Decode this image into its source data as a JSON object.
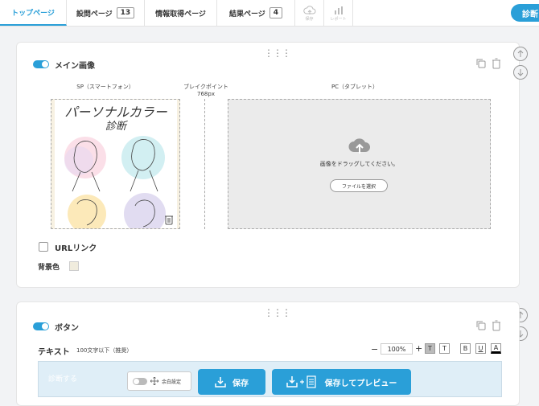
{
  "topbar": {
    "tabs": [
      {
        "label": "トップページ"
      },
      {
        "label": "設問ページ",
        "count": "13"
      },
      {
        "label": "情報取得ページ"
      },
      {
        "label": "結果ページ",
        "count": "4"
      }
    ],
    "tools": [
      {
        "icon": "cloud-save-icon",
        "label": "保存"
      },
      {
        "icon": "report-icon",
        "label": "レポート"
      }
    ],
    "diagnose_label": "診断"
  },
  "main_image": {
    "title": "メイン画像",
    "enabled": true,
    "sp_label": "SP（スマートフォン）",
    "breakpoint_label": "ブレイクポイント",
    "breakpoint_value": "768px",
    "pc_label": "PC（タブレット）",
    "drop_text": "画像をドラッグしてください。",
    "file_button": "ファイルを選択",
    "preview_title_line1": "パーソナルカラー",
    "preview_title_line2": "診断",
    "url_link_label": "URLリンク",
    "bg_color_label": "背景色",
    "bg_color": "#f0ecdd"
  },
  "button_section": {
    "title": "ボタン",
    "enabled": true,
    "text_label": "テキスト",
    "text_hint": "100文字以下（推奨）",
    "zoom": "100%",
    "minus": "−",
    "plus": "+",
    "fmt": [
      "T",
      "T",
      "B",
      "U",
      "A"
    ],
    "input_value": "診断する"
  },
  "bottom_bar": {
    "margin_toggle_label": "余白設定",
    "save_label": "保存",
    "save_preview_label": "保存してプレビュー"
  },
  "colors": {
    "accent": "#2a9fd8"
  }
}
